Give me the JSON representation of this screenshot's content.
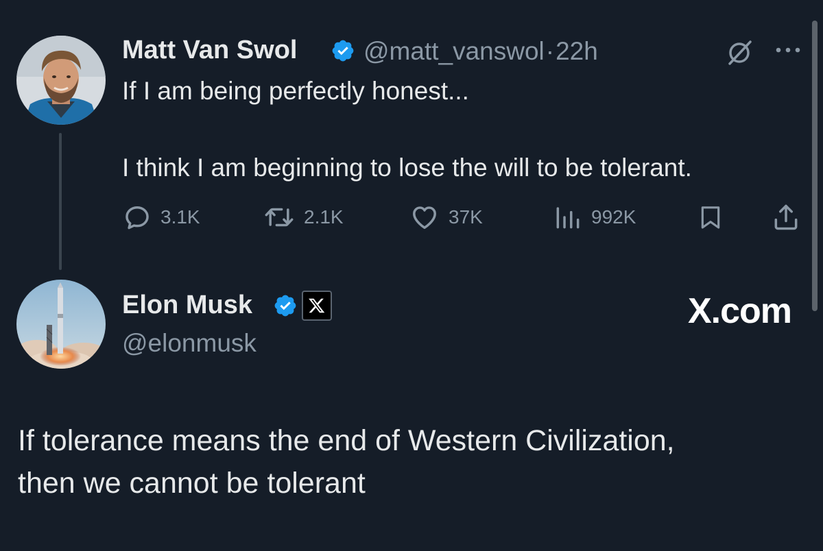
{
  "tweet": {
    "author_name": "Matt Van Swol",
    "handle": "@matt_vanswol",
    "separator": "·",
    "time": "22h",
    "text_line1": "If I am being perfectly honest...",
    "text_line2": "I think I am beginning to lose the will to be tolerant.",
    "stats": {
      "replies": "3.1K",
      "reposts": "2.1K",
      "likes": "37K",
      "views": "992K"
    }
  },
  "reply": {
    "author_name": "Elon Musk",
    "handle": "@elonmusk",
    "site": "X.com",
    "text_line1": "If tolerance means the end of Western Civilization,",
    "text_line2": "then we cannot be tolerant"
  },
  "icons": {
    "verified": "verified-badge-icon",
    "grok": "grok-slash-icon",
    "more": "more-dots-icon",
    "reply": "reply-icon",
    "repost": "repost-icon",
    "like": "heart-icon",
    "views": "views-bars-icon",
    "bookmark": "bookmark-icon",
    "share": "share-icon",
    "x_logo": "x-logo-icon"
  },
  "colors": {
    "background": "#151d28",
    "text": "#e7e9ea",
    "muted": "#8b98a5",
    "verified": "#1d9bf0"
  }
}
